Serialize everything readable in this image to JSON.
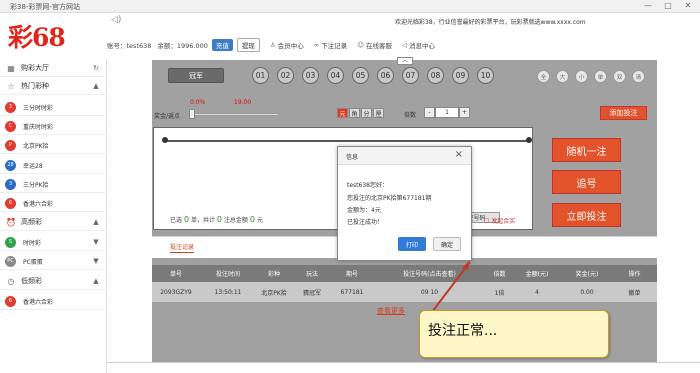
{
  "window": {
    "title": "彩38-彩票网-官方网站",
    "controls": [
      "—",
      "□",
      "✕"
    ]
  },
  "logo": "彩68",
  "notice": "欢迎光临彩38，行业信誉最好的彩票平台，玩彩票就选www.xxxx.com",
  "account": {
    "user": "账号：test638",
    "balance": "余额：1996.000",
    "recharge": "充值",
    "withdraw": "提现",
    "links": [
      {
        "label": "会员中心",
        "icon": "user-icon"
      },
      {
        "label": "下注记录",
        "icon": "link-icon"
      },
      {
        "label": "在线客服",
        "icon": "chat-icon"
      },
      {
        "label": "消息中心",
        "icon": "speaker-icon"
      }
    ]
  },
  "sidebar": {
    "lobby": "购彩大厅",
    "hot": "热门彩种",
    "hot_items": [
      "三分时时彩",
      "重庆时时彩",
      "北京PK拾",
      "幸运28",
      "三分PK拾",
      "香港六合彩"
    ],
    "high": "高频彩",
    "high_items": [
      "时时彩",
      "PC蛋蛋"
    ],
    "low": "低频彩",
    "low_items": [
      "香港六合彩"
    ]
  },
  "game": {
    "position": "冠军",
    "balls": [
      "01",
      "02",
      "03",
      "04",
      "05",
      "06",
      "07",
      "08",
      "09",
      "10"
    ],
    "quick": [
      "全",
      "大",
      "小",
      "单",
      "双",
      "清"
    ],
    "rebate_label": "奖金/返点",
    "rebate_pct": "0.0%",
    "prize": "19.00",
    "modes": [
      "元",
      "角",
      "分",
      "厘"
    ],
    "multiple_label": "倍数",
    "multiple_minus": "-",
    "multiple_value": "1",
    "multiple_plus": "+",
    "add_button": "添加投注"
  },
  "footer": {
    "prefix": "已选",
    "notes": "0",
    "mid1": "单，共计",
    "total_notes": "0",
    "mid2": "注总金额",
    "amount": "0",
    "suffix": "元",
    "clear": "清空号码",
    "joint": "发起合买"
  },
  "actions": {
    "random": "随机一注",
    "chase": "追号",
    "bet": "立即投注"
  },
  "history": {
    "tab": "投注记录",
    "headers": [
      "单号",
      "投注时间",
      "彩种",
      "玩法",
      "期号",
      "投注号码(点击查看)",
      "倍数",
      "金额(元)",
      "奖金(元)",
      "操作"
    ],
    "rows": [
      [
        "2093GZY9",
        "13:50:11",
        "北京PK拾",
        "猜冠军",
        "677181",
        "09 10",
        "1倍",
        "4",
        "0.00",
        "撤单"
      ]
    ],
    "more": "查看更多"
  },
  "modal": {
    "title": "信息",
    "line1": "test638您好：",
    "line2": "您投注的北京PK拾第677181期",
    "line3": "金额为：4元",
    "line4": "已投注成功！",
    "print": "打印",
    "confirm": "确定"
  },
  "callout": "投注正常..."
}
